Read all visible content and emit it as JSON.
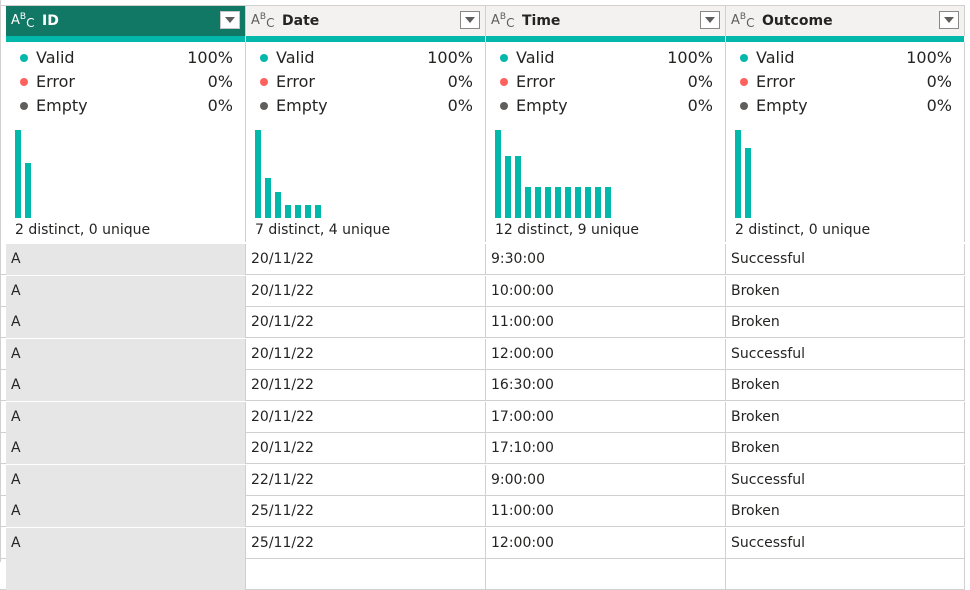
{
  "columns": [
    {
      "name": "ID",
      "type_icon": "text-type-icon",
      "selected": true,
      "stats": {
        "valid_label": "Valid",
        "valid_pct": "100%",
        "error_label": "Error",
        "error_pct": "0%",
        "empty_label": "Empty",
        "empty_pct": "0%"
      },
      "histogram": [
        1.0,
        0.62
      ],
      "distinct_text": "2 distinct, 0 unique"
    },
    {
      "name": "Date",
      "type_icon": "text-type-icon",
      "selected": false,
      "stats": {
        "valid_label": "Valid",
        "valid_pct": "100%",
        "error_label": "Error",
        "error_pct": "0%",
        "empty_label": "Empty",
        "empty_pct": "0%"
      },
      "histogram": [
        1.0,
        0.45,
        0.3,
        0.15,
        0.15,
        0.15,
        0.15
      ],
      "distinct_text": "7 distinct, 4 unique"
    },
    {
      "name": "Time",
      "type_icon": "text-type-icon",
      "selected": false,
      "stats": {
        "valid_label": "Valid",
        "valid_pct": "100%",
        "error_label": "Error",
        "error_pct": "0%",
        "empty_label": "Empty",
        "empty_pct": "0%"
      },
      "histogram": [
        1.0,
        0.7,
        0.7,
        0.35,
        0.35,
        0.35,
        0.35,
        0.35,
        0.35,
        0.35,
        0.35,
        0.35
      ],
      "distinct_text": "12 distinct, 9 unique"
    },
    {
      "name": "Outcome",
      "type_icon": "text-type-icon",
      "selected": false,
      "stats": {
        "valid_label": "Valid",
        "valid_pct": "100%",
        "error_label": "Error",
        "error_pct": "0%",
        "empty_label": "Empty",
        "empty_pct": "0%"
      },
      "histogram": [
        1.0,
        0.8
      ],
      "distinct_text": "2 distinct, 0 unique"
    }
  ],
  "rows": [
    [
      "A",
      "20/11/22",
      "9:30:00",
      "Successful"
    ],
    [
      "A",
      "20/11/22",
      "10:00:00",
      "Broken"
    ],
    [
      "A",
      "20/11/22",
      "11:00:00",
      "Broken"
    ],
    [
      "A",
      "20/11/22",
      "12:00:00",
      "Successful"
    ],
    [
      "A",
      "20/11/22",
      "16:30:00",
      "Broken"
    ],
    [
      "A",
      "20/11/22",
      "17:00:00",
      "Broken"
    ],
    [
      "A",
      "20/11/22",
      "17:10:00",
      "Broken"
    ],
    [
      "A",
      "22/11/22",
      "9:00:00",
      "Successful"
    ],
    [
      "A",
      "25/11/22",
      "11:00:00",
      "Broken"
    ],
    [
      "A",
      "25/11/22",
      "12:00:00",
      "Successful"
    ],
    [
      "",
      "",
      "",
      ""
    ]
  ],
  "colors": {
    "accent": "#117865",
    "valid": "#01b8aa",
    "error": "#fd625e",
    "empty": "#605e5c",
    "bar": "#01b8aa"
  }
}
